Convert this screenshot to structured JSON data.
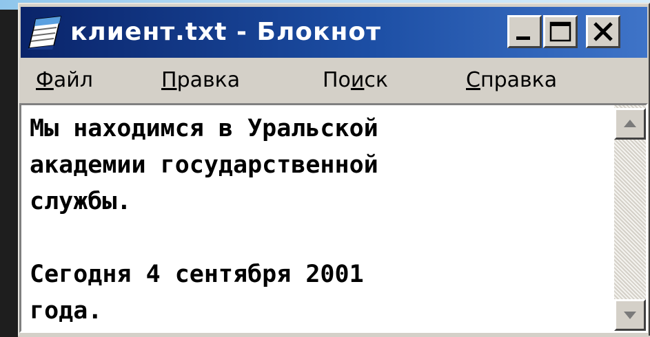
{
  "window": {
    "title": "клиент.txt - Блокнот",
    "icon": "notepad-icon",
    "controls": [
      "minimize-icon",
      "maximize-icon",
      "close-icon"
    ]
  },
  "menubar": {
    "items": [
      {
        "label_pre": "",
        "label_ul": "Ф",
        "label_post": "айл"
      },
      {
        "label_pre": "",
        "label_ul": "П",
        "label_post": "равка"
      },
      {
        "label_pre": "По",
        "label_ul": "и",
        "label_post": "ск"
      },
      {
        "label_pre": "",
        "label_ul": "С",
        "label_post": "правка"
      }
    ]
  },
  "document": {
    "lines": [
      "Мы находимся в Уральской",
      "академии государственной",
      "службы.",
      "",
      "Сегодня 4 сентября 2001",
      "года."
    ]
  },
  "colors": {
    "titlebar_start": "#0a246a",
    "titlebar_end": "#3f74c8",
    "chrome": "#d4d0c8"
  }
}
